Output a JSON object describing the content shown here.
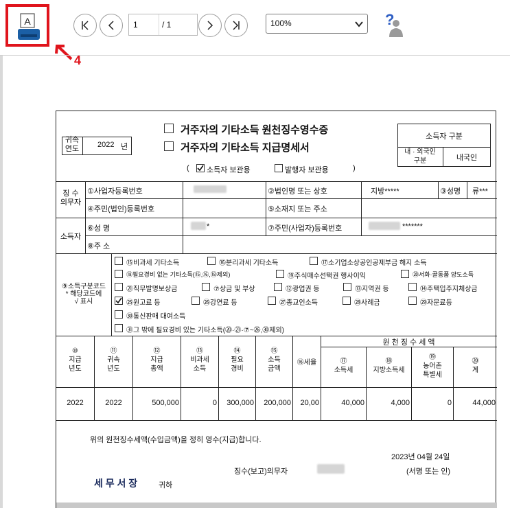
{
  "toolbar": {
    "print_icon_letter": "A",
    "annotation_number": "4",
    "page_current": "1",
    "page_total": "/ 1",
    "zoom": "100%",
    "help_glyph": "?",
    "icons": [
      "printer-icon",
      "first-page-icon",
      "prev-page-icon",
      "next-page-icon",
      "last-page-icon",
      "help-icon"
    ]
  },
  "form": {
    "title1": "거주자의 기타소득 원천징수영수증",
    "title2": "거주자의 기타소득 지급명세서",
    "year_label": "귀속\n연도",
    "year_value": "2022",
    "year_suffix": "년",
    "earner_type_label": "소득자 구분",
    "foreign_label": "내 · 외국인\n구분",
    "foreign_value": "내국인",
    "copy_open": "(",
    "copy_earner": "소득자 보관용",
    "copy_issuer": "발행자 보관용",
    "copy_close": ")",
    "withholder_label": "징 수\n의무자",
    "f1": "①사업자등록번호",
    "f2": "②법인명 또는 상호",
    "f2_value": "지방*****",
    "f3": "③성명",
    "f3_value": "류***",
    "f4": "④주민(법인)등록번호",
    "f5": "⑤소재지 또는 주소",
    "earner_label": "소득자",
    "f6": "⑥성          명",
    "f6_suffix": "*",
    "f7": "⑦주민(사업자)등록번호",
    "f7_value": "*******",
    "f8": "⑧주          소",
    "f9_label": "⑨소득구분코드\n* 해당코드에\n√ 표시",
    "codes": [
      "⑮비과세 기타소득",
      "⑯분리과세 기타소득",
      "⑰소기업소상공인공제부금 해지 소득",
      "⑱필요경비 없는 기타소득(⑮,⑯,⑱제외)",
      "⑲주식매수선택권 행사이익",
      "⑳서화·골동품 양도소득",
      "㉑직무발명보상금",
      "⑦상금 및 부상",
      "⑫광업권 등",
      "⑬지역권 등",
      "⑭주택입주지체상금",
      "㉕원고료 등",
      "㉖강연료 등",
      "㉗종교인소득",
      "㉘사례금",
      "㉙자문료등",
      "㉚통신판매 대여소득",
      "㉛그 밖에 필요경비 있는 기타소득(⑳·㉑·⑦~㉖,㉚제외)"
    ],
    "checked_code": "㉕원고료 등",
    "tax_header": "원 천 징 수 세 액",
    "col10": "⑩\n지급\n년도",
    "col11": "⑪\n귀속\n년도",
    "col12": "⑫\n지급\n총액",
    "col13": "⑬\n비과세\n소득",
    "col14": "⑭\n필요\n경비",
    "col15": "⑮\n소득\n금액",
    "col16": "⑯세율",
    "col17": "⑰\n소득세",
    "col18": "⑱\n지방소득세",
    "col19": "⑲\n농어촌\n특별세",
    "col20": "⑳\n계",
    "row": {
      "pay_year": "2022",
      "attr_year": "2022",
      "total": "500,000",
      "nontax": "0",
      "expense": "300,000",
      "income": "200,000",
      "rate": "20,00",
      "income_tax": "40,000",
      "local_tax": "4,000",
      "rural_tax": "0",
      "sum": "44,000"
    },
    "statement": "위의 원천징수세액(수입금액)을 정히 영수(지급)합니다.",
    "date": "2023년 04월 24일",
    "signer_label": "징수(보고)의무자",
    "sign_note": "(서명 또는 인)",
    "office": "세 무 서 장",
    "office_suffix": "귀하"
  }
}
